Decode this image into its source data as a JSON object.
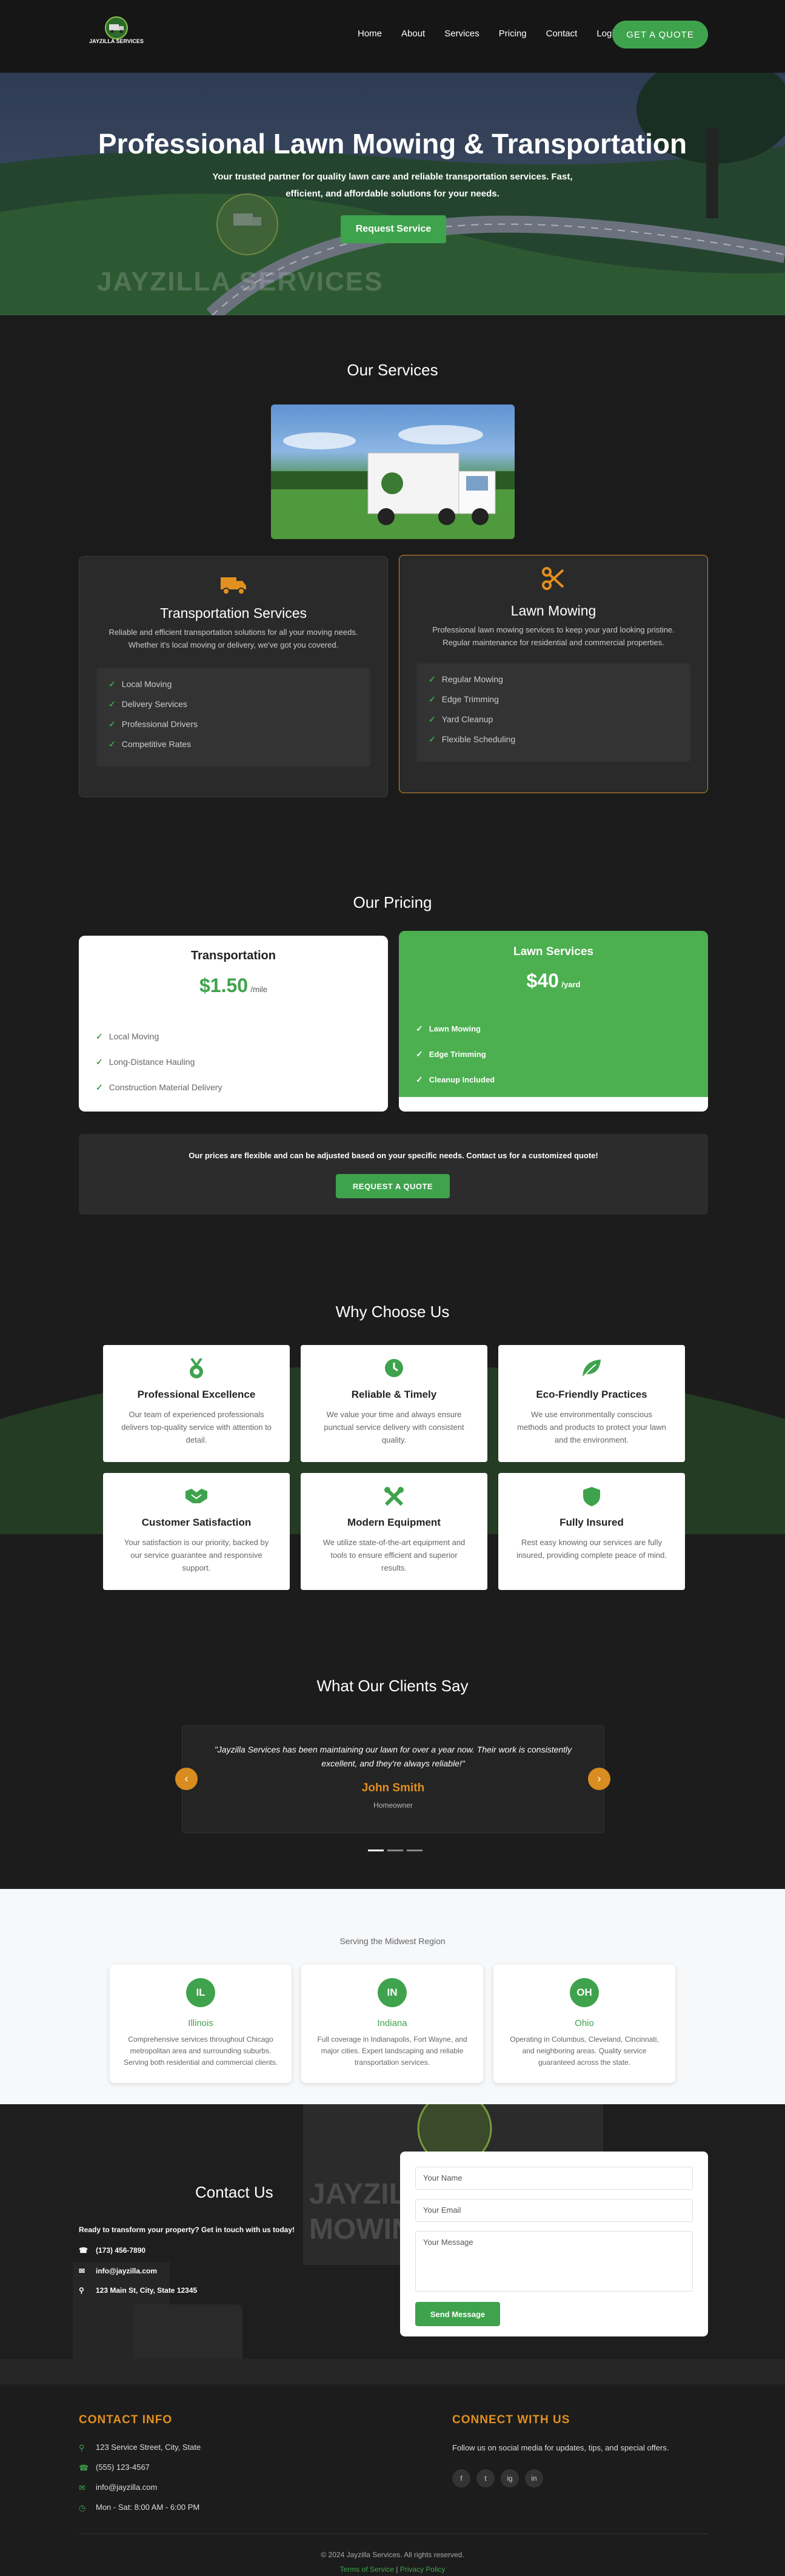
{
  "nav": {
    "logo_text": "JAYZILLA SERVICES",
    "links": [
      "Home",
      "About",
      "Services",
      "Pricing",
      "Contact",
      "Login"
    ],
    "cta": "GET A QUOTE"
  },
  "hero": {
    "title": "Professional Lawn Mowing & Transportation",
    "subtitle": "Your trusted partner for quality lawn care and reliable transportation services. Fast, efficient, and affordable solutions for your needs.",
    "button": "Request Service",
    "watermark": "JAYZILLA SERVICES"
  },
  "services": {
    "heading": "Our Services",
    "cards": [
      {
        "icon": "truck-icon",
        "title": "Transportation Services",
        "desc": "Reliable and efficient transportation solutions for all your moving needs. Whether it's local moving or delivery, we've got you covered.",
        "items": [
          "Local Moving",
          "Delivery Services",
          "Professional Drivers",
          "Competitive Rates"
        ]
      },
      {
        "icon": "scissors-icon",
        "title": "Lawn Mowing",
        "desc": "Professional lawn mowing services to keep your yard looking pristine. Regular maintenance for residential and commercial properties.",
        "items": [
          "Regular Mowing",
          "Edge Trimming",
          "Yard Cleanup",
          "Flexible Scheduling"
        ]
      }
    ]
  },
  "pricing": {
    "heading": "Our Pricing",
    "transport": {
      "title": "Transportation",
      "price": "$1.50",
      "unit": "/mile",
      "items": [
        "Local Moving",
        "Long-Distance Hauling",
        "Construction Material Delivery"
      ]
    },
    "lawn": {
      "title": "Lawn Services",
      "price": "$40",
      "unit": "/yard",
      "items": [
        "Lawn Mowing",
        "Edge Trimming",
        "Cleanup Included"
      ]
    },
    "note": "Our prices are flexible and can be adjusted based on your specific needs. Contact us for a customized quote!",
    "note_button": "REQUEST A QUOTE"
  },
  "why": {
    "heading": "Why Choose Us",
    "cards": [
      {
        "icon": "medal-icon",
        "title": "Professional Excellence",
        "desc": "Our team of experienced professionals delivers top-quality service with attention to detail."
      },
      {
        "icon": "clock-icon",
        "title": "Reliable & Timely",
        "desc": "We value your time and always ensure punctual service delivery with consistent quality."
      },
      {
        "icon": "leaf-icon",
        "title": "Eco-Friendly Practices",
        "desc": "We use environmentally conscious methods and products to protect your lawn and the environment."
      },
      {
        "icon": "handshake-icon",
        "title": "Customer Satisfaction",
        "desc": "Your satisfaction is our priority, backed by our service guarantee and responsive support."
      },
      {
        "icon": "tools-icon",
        "title": "Modern Equipment",
        "desc": "We utilize state-of-the-art equipment and tools to ensure efficient and superior results."
      },
      {
        "icon": "shield-icon",
        "title": "Fully Insured",
        "desc": "Rest easy knowing our services are fully insured, providing complete peace of mind."
      }
    ]
  },
  "testimonials": {
    "heading": "What Our Clients Say",
    "quote": "\"Jayzilla Services has been maintaining our lawn for over a year now. Their work is consistently excellent, and they're always reliable!\"",
    "name": "John Smith",
    "role": "Homeowner",
    "prev": "‹",
    "next": "›"
  },
  "regions": {
    "heading": "Serving the Midwest Region",
    "cards": [
      {
        "abbr": "IL",
        "name": "Illinois",
        "desc": "Comprehensive services throughout Chicago metropolitan area and surrounding suburbs. Serving both residential and commercial clients."
      },
      {
        "abbr": "IN",
        "name": "Indiana",
        "desc": "Full coverage in Indianapolis, Fort Wayne, and major cities. Expert landscaping and reliable transportation services."
      },
      {
        "abbr": "OH",
        "name": "Ohio",
        "desc": "Operating in Columbus, Cleveland, Cincinnati, and neighboring areas. Quality service guaranteed across the state."
      }
    ]
  },
  "contact": {
    "heading": "Contact Us",
    "intro": "Ready to transform your property? Get in touch with us today!",
    "phone": "(173) 456-7890",
    "email": "info@jayzilla.com",
    "address": "123 Main St, City, State 12345",
    "form": {
      "name": "Your Name",
      "email": "Your Email",
      "message": "Your Message",
      "submit": "Send Message"
    },
    "bg_text": "JAYZILLA LAWN MOWING"
  },
  "footer": {
    "info_heading": "CONTACT INFO",
    "info": [
      "123 Service Street, City, State",
      "(555) 123-4567",
      "info@jayzilla.com",
      "Mon - Sat: 8:00 AM - 6:00 PM"
    ],
    "connect_heading": "CONNECT WITH US",
    "connect_text": "Follow us on social media for updates, tips, and special offers.",
    "social": [
      "f",
      "t",
      "ig",
      "in"
    ],
    "copyright": "© 2024 Jayzilla Services. All rights reserved.",
    "terms": "Terms of Service",
    "sep": "|",
    "privacy": "Privacy Policy"
  },
  "colors": {
    "green": "#3fa34d",
    "orange": "#e2901f",
    "dark": "#1c1c1c"
  }
}
